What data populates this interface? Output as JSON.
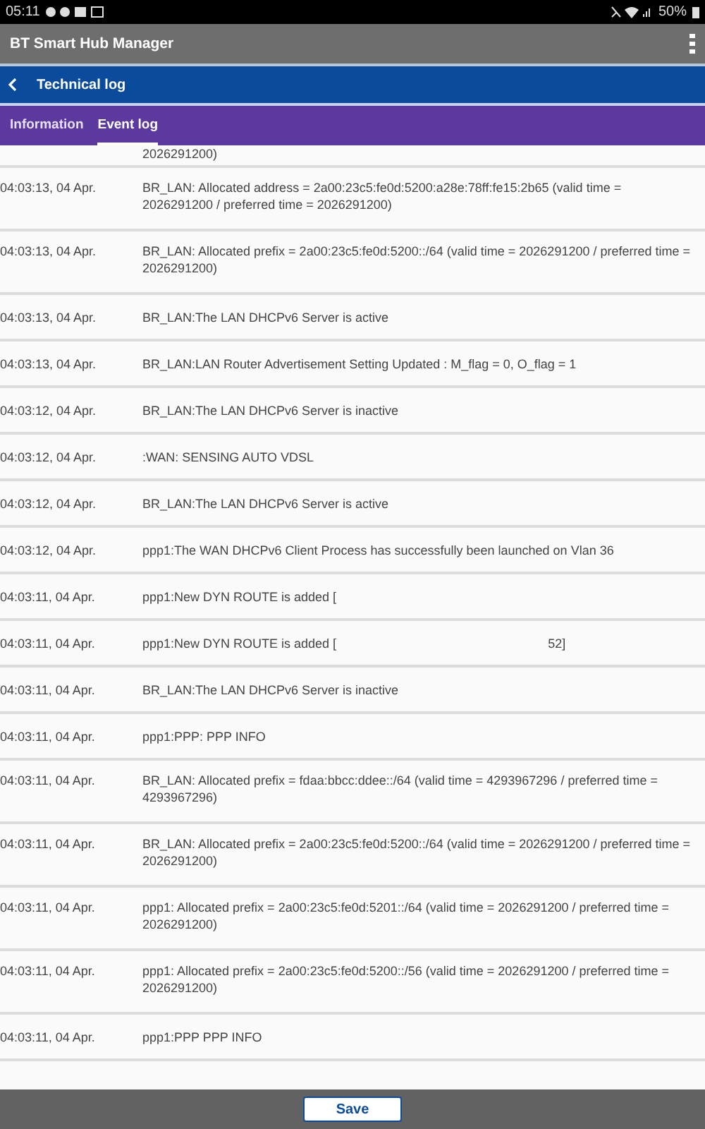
{
  "status_bar": {
    "time": "05:11",
    "battery": "50%"
  },
  "app_bar": {
    "title": "BT Smart Hub Manager"
  },
  "page_header": {
    "title": "Technical log"
  },
  "tabs": [
    {
      "label": "Information",
      "selected": false
    },
    {
      "label": "Event log",
      "selected": true
    }
  ],
  "log": {
    "partial_top": "2026291200)",
    "entries": [
      {
        "time": "04:03:13, 04 Apr.",
        "message": "BR_LAN: Allocated address = 2a00:23c5:fe0d:5200:a28e:78ff:fe15:2b65 (valid time = 2026291200 / preferred time = 2026291200)"
      },
      {
        "time": "04:03:13, 04 Apr.",
        "message": "BR_LAN: Allocated prefix = 2a00:23c5:fe0d:5200::/64 (valid time = 2026291200 / preferred time = 2026291200)"
      },
      {
        "time": "04:03:13, 04 Apr.",
        "message": "BR_LAN:The LAN DHCPv6 Server is active"
      },
      {
        "time": "04:03:13, 04 Apr.",
        "message": "BR_LAN:LAN Router Advertisement Setting Updated : M_flag = 0, O_flag = 1"
      },
      {
        "time": "04:03:12, 04 Apr.",
        "message": "BR_LAN:The LAN DHCPv6 Server is inactive"
      },
      {
        "time": "04:03:12, 04 Apr.",
        "message": ":WAN: SENSING AUTO VDSL"
      },
      {
        "time": "04:03:12, 04 Apr.",
        "message": "BR_LAN:The LAN DHCPv6 Server is active"
      },
      {
        "time": "04:03:12, 04 Apr.",
        "message": "ppp1:The WAN DHCPv6 Client Process has successfully been launched on Vlan 36"
      },
      {
        "time": "04:03:11, 04 Apr.",
        "message": "ppp1:New DYN ROUTE is added ["
      },
      {
        "time": "04:03:11, 04 Apr.",
        "message": "ppp1:New DYN ROUTE is added [",
        "tail": "52]"
      },
      {
        "time": "04:03:11, 04 Apr.",
        "message": "BR_LAN:The LAN DHCPv6 Server is inactive"
      },
      {
        "time": "04:03:11, 04 Apr.",
        "message": "ppp1:PPP: PPP INFO"
      },
      {
        "time": "04:03:11, 04 Apr.",
        "message": "BR_LAN: Allocated prefix = fdaa:bbcc:ddee::/64 (valid time = 4293967296 / preferred time = 4293967296)"
      },
      {
        "time": "04:03:11, 04 Apr.",
        "message": "BR_LAN: Allocated prefix = 2a00:23c5:fe0d:5200::/64 (valid time = 2026291200 / preferred time = 2026291200)"
      },
      {
        "time": "04:03:11, 04 Apr.",
        "message": "ppp1: Allocated prefix = 2a00:23c5:fe0d:5201::/64 (valid time = 2026291200 / preferred time = 2026291200)"
      },
      {
        "time": "04:03:11, 04 Apr.",
        "message": "ppp1: Allocated prefix = 2a00:23c5:fe0d:5200::/56 (valid time = 2026291200 / preferred time = 2026291200)"
      },
      {
        "time": "04:03:11, 04 Apr.",
        "message": "ppp1:PPP PPP INFO"
      }
    ]
  },
  "save_button": {
    "label": "Save"
  }
}
